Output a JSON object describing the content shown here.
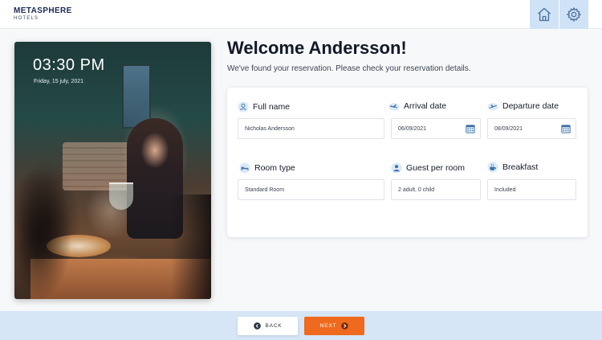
{
  "brand": {
    "name": "METASPHERE",
    "sub": "HOTELS"
  },
  "header": {
    "home_icon": "home-icon",
    "settings_icon": "gear-icon",
    "button_bg": "#cfe2f6"
  },
  "clock": {
    "time": "03:30 PM",
    "date": "Friday, 15 july, 2021"
  },
  "welcome": {
    "title": "Welcome Andersson!",
    "subtitle": "We've found your reservation. Please check your reservation details."
  },
  "reservation": {
    "full_name": {
      "label": "Full name",
      "value": "Nicholas Andersson",
      "icon": "user-icon"
    },
    "arrival": {
      "label": "Arrival date",
      "value": "06/09/2021",
      "icon": "plane-arrival-icon"
    },
    "departure": {
      "label": "Departure date",
      "value": "08/09/2021",
      "icon": "plane-departure-icon"
    },
    "room_type": {
      "label": "Room type",
      "value": "Standard Room",
      "icon": "bed-icon"
    },
    "guests": {
      "label": "Guest per room",
      "value": "2 adult, 0 child",
      "icon": "guests-icon"
    },
    "breakfast": {
      "label": "Breakfast",
      "value": "Included",
      "icon": "breakfast-icon"
    }
  },
  "footer": {
    "back_label": "BACK",
    "next_label": "NEXT",
    "accent": "#ef6a1e",
    "bar_bg": "#d6e6f7"
  }
}
